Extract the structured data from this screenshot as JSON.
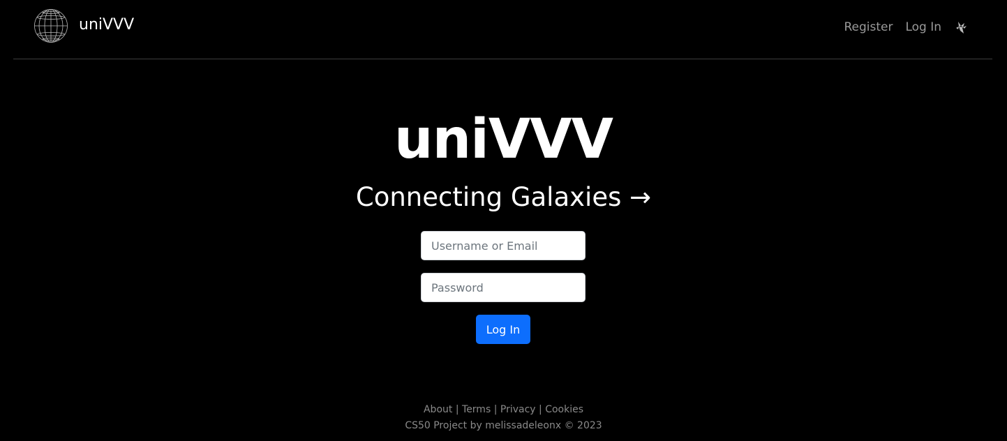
{
  "navbar": {
    "brand_text": "uniVVV",
    "logo_icon": "wireframe-globe-icon",
    "links": {
      "register": "Register",
      "login": "Log In"
    },
    "theme_toggle_icon": "theme-toggle-icon"
  },
  "hero": {
    "title": "uniVVV",
    "subtitle": "Connecting Galaxies →"
  },
  "login_form": {
    "username_placeholder": "Username or Email",
    "username_value": "",
    "password_placeholder": "Password",
    "password_value": "",
    "submit_label": "Log In"
  },
  "footer": {
    "links": {
      "about": "About",
      "terms": "Terms",
      "privacy": "Privacy",
      "cookies": "Cookies"
    },
    "separator": "|",
    "credit": "CS50 Project by melissadeleonx © 2023"
  },
  "colors": {
    "background": "#000000",
    "primary_button": "#0d6efd",
    "nav_link": "#9a9a9a",
    "footer_text": "#8a8a8a",
    "divider": "#3d3d3d"
  }
}
